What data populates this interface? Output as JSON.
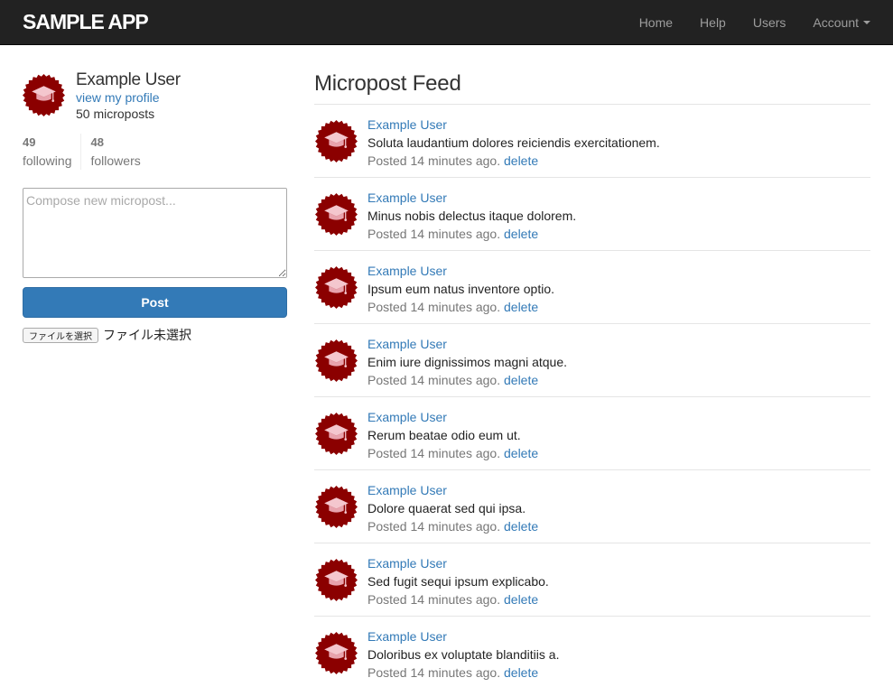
{
  "nav": {
    "brand": "SAMPLE APP",
    "items": [
      "Home",
      "Help",
      "Users",
      "Account"
    ]
  },
  "user": {
    "name": "Example User",
    "profile_link": "view my profile",
    "microposts": "50 microposts",
    "following_count": "49",
    "following_label": "following",
    "followers_count": "48",
    "followers_label": "followers"
  },
  "compose": {
    "placeholder": "Compose new micropost...",
    "value": "",
    "post_label": "Post",
    "file_button": "ファイルを選択",
    "file_status": "ファイル未選択"
  },
  "feed": {
    "title": "Micropost Feed",
    "items": [
      {
        "user": "Example User",
        "content": "Soluta laudantium dolores reiciendis exercitationem.",
        "time": "Posted 14 minutes ago.",
        "delete": "delete"
      },
      {
        "user": "Example User",
        "content": "Minus nobis delectus itaque dolorem.",
        "time": "Posted 14 minutes ago.",
        "delete": "delete"
      },
      {
        "user": "Example User",
        "content": "Ipsum eum natus inventore optio.",
        "time": "Posted 14 minutes ago.",
        "delete": "delete"
      },
      {
        "user": "Example User",
        "content": "Enim iure dignissimos magni atque.",
        "time": "Posted 14 minutes ago.",
        "delete": "delete"
      },
      {
        "user": "Example User",
        "content": "Rerum beatae odio eum ut.",
        "time": "Posted 14 minutes ago.",
        "delete": "delete"
      },
      {
        "user": "Example User",
        "content": "Dolore quaerat sed qui ipsa.",
        "time": "Posted 14 minutes ago.",
        "delete": "delete"
      },
      {
        "user": "Example User",
        "content": "Sed fugit sequi ipsum explicabo.",
        "time": "Posted 14 minutes ago.",
        "delete": "delete"
      },
      {
        "user": "Example User",
        "content": "Doloribus ex voluptate blanditiis a.",
        "time": "Posted 14 minutes ago.",
        "delete": "delete"
      }
    ]
  },
  "colors": {
    "navbar": "#222222",
    "link": "#337ab7",
    "button": "#337ab7",
    "avatar": "#8b0000"
  },
  "icons": {
    "avatar": "graduation-cap-seal-icon"
  }
}
